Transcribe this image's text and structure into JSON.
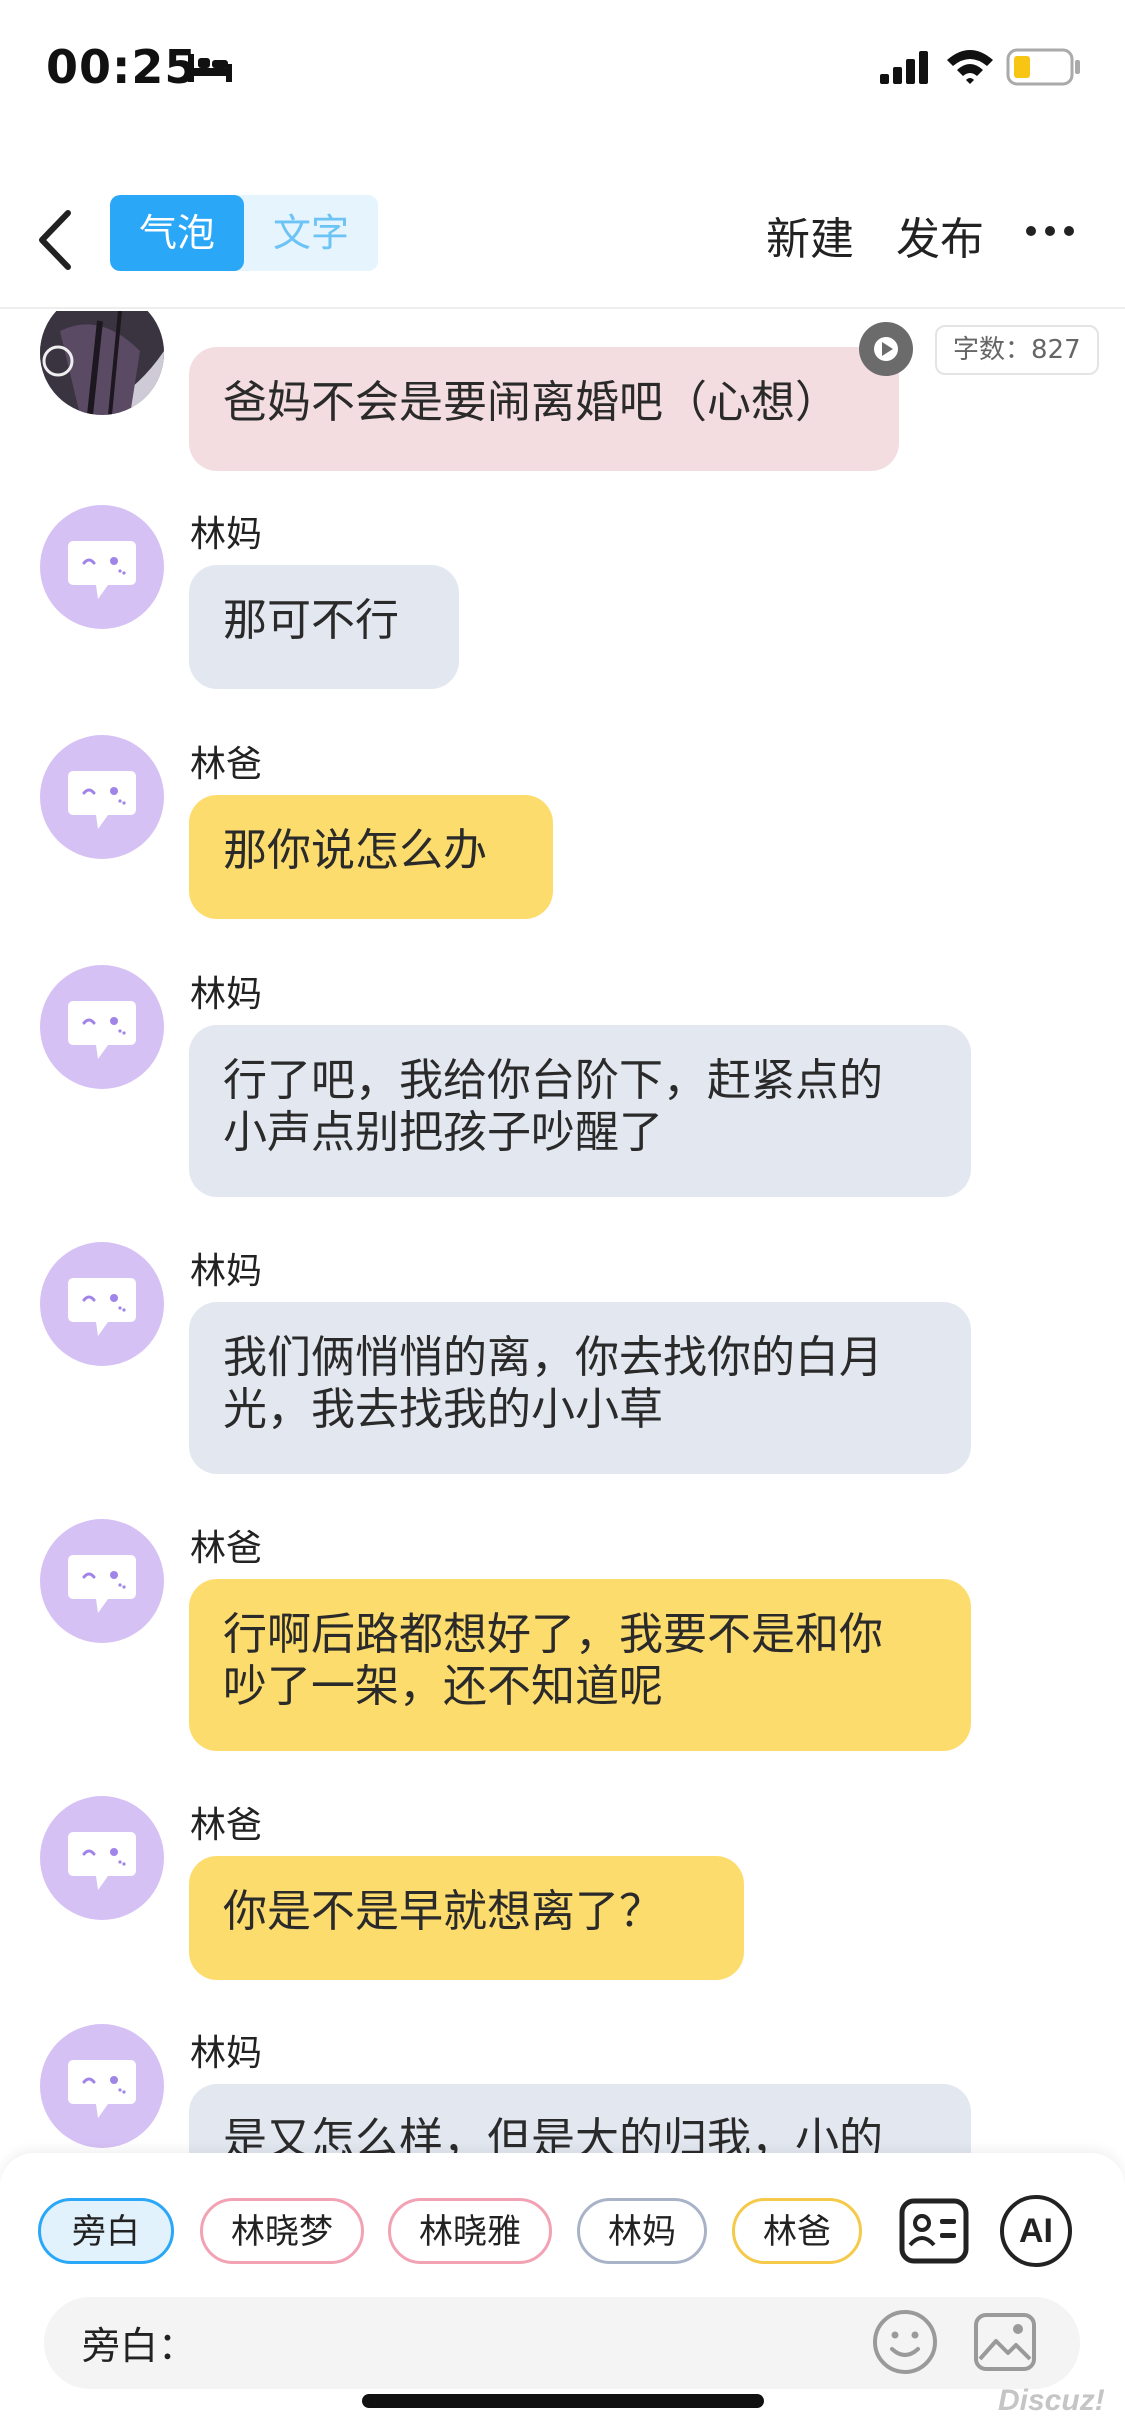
{
  "status_bar": {
    "time": "00:25"
  },
  "nav": {
    "segment_bubble": "气泡",
    "segment_text": "文字",
    "new_label": "新建",
    "publish_label": "发布"
  },
  "word_count": "字数：827",
  "messages": [
    {
      "speaker": "",
      "text": "爸妈不会是要闹离婚吧（心想）",
      "style": "pink"
    },
    {
      "speaker": "林妈",
      "text": "那可不行",
      "style": "gray"
    },
    {
      "speaker": "林爸",
      "text": "那你说怎么办",
      "style": "yellow"
    },
    {
      "speaker": "林妈",
      "line1": "行了吧，我给你台阶下，赶紧点的",
      "line2": "小声点别把孩子吵醒了",
      "style": "gray"
    },
    {
      "speaker": "林妈",
      "line1": "我们俩悄悄的离，你去找你的白月",
      "line2": "光，我去找我的小小草",
      "style": "gray"
    },
    {
      "speaker": "林爸",
      "line1": "行啊后路都想好了，我要不是和你",
      "line2": "吵了一架，还不知道呢",
      "style": "yellow"
    },
    {
      "speaker": "林爸",
      "text": "你是不是早就想离了？",
      "style": "yellow"
    },
    {
      "speaker": "林妈",
      "text": "是又怎么样，但是大的归我，小的",
      "style": "gray"
    }
  ],
  "roles": [
    "旁白",
    "林晓梦",
    "林晓雅",
    "林妈",
    "林爸"
  ],
  "ai_label": "AI",
  "input": {
    "label": "旁白："
  },
  "watermark": "Discuz!",
  "colors": {
    "accent": "#2aa7f7",
    "bubble_gray": "#e3e8f0",
    "bubble_yellow": "#fddc6e",
    "bubble_pink": "#f3dde0",
    "avatar": "#d6c1f5"
  }
}
